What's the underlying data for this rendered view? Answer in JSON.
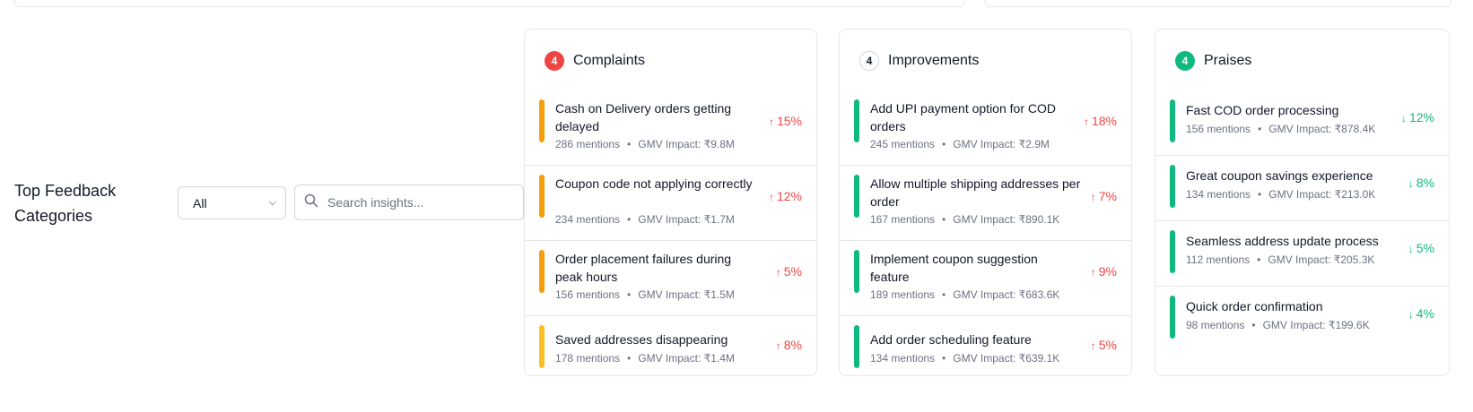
{
  "section": {
    "heading": "Top Feedback Categories",
    "filter": {
      "selected": "All"
    },
    "search": {
      "placeholder": "Search insights..."
    }
  },
  "colors": {
    "orange": "#f59e0b",
    "amber": "#fbbf24",
    "green": "#10b981",
    "red": "#ef4444"
  },
  "cards": [
    {
      "title": "Complaints",
      "count": "4",
      "items": [
        {
          "title": "Cash on Delivery orders getting delayed",
          "mentions": "286 mentions",
          "gmv": "GMV Impact: ₹9.8M",
          "change": "15%",
          "direction": "up"
        },
        {
          "title": "Coupon code not applying correctly",
          "mentions": "234 mentions",
          "gmv": "GMV Impact: ₹1.7M",
          "change": "12%",
          "direction": "up"
        },
        {
          "title": "Order placement failures during peak hours",
          "mentions": "156 mentions",
          "gmv": "GMV Impact: ₹1.5M",
          "change": "5%",
          "direction": "up"
        },
        {
          "title": "Saved addresses disappearing",
          "mentions": "178 mentions",
          "gmv": "GMV Impact: ₹1.4M",
          "change": "8%",
          "direction": "up"
        }
      ]
    },
    {
      "title": "Improvements",
      "count": "4",
      "items": [
        {
          "title": "Add UPI payment option for COD orders",
          "mentions": "245 mentions",
          "gmv": "GMV Impact: ₹2.9M",
          "change": "18%",
          "direction": "up"
        },
        {
          "title": "Allow multiple shipping addresses per order",
          "mentions": "167 mentions",
          "gmv": "GMV Impact: ₹890.1K",
          "change": "7%",
          "direction": "up"
        },
        {
          "title": "Implement coupon suggestion feature",
          "mentions": "189 mentions",
          "gmv": "GMV Impact: ₹683.6K",
          "change": "9%",
          "direction": "up"
        },
        {
          "title": "Add order scheduling feature",
          "mentions": "134 mentions",
          "gmv": "GMV Impact: ₹639.1K",
          "change": "5%",
          "direction": "up"
        }
      ]
    },
    {
      "title": "Praises",
      "count": "4",
      "items": [
        {
          "title": "Fast COD order processing",
          "mentions": "156 mentions",
          "gmv": "GMV Impact: ₹878.4K",
          "change": "12%",
          "direction": "down"
        },
        {
          "title": "Great coupon savings experience",
          "mentions": "134 mentions",
          "gmv": "GMV Impact: ₹213.0K",
          "change": "8%",
          "direction": "down"
        },
        {
          "title": "Seamless address update process",
          "mentions": "112 mentions",
          "gmv": "GMV Impact: ₹205.3K",
          "change": "5%",
          "direction": "down"
        },
        {
          "title": "Quick order confirmation",
          "mentions": "98 mentions",
          "gmv": "GMV Impact: ₹199.6K",
          "change": "4%",
          "direction": "down"
        }
      ]
    }
  ]
}
